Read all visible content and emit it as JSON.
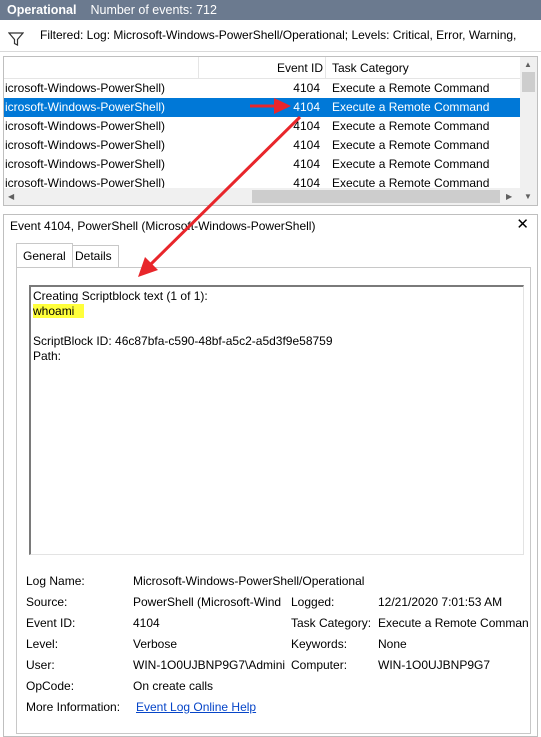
{
  "header": {
    "title": "Operational",
    "count_label": "Number of events: 712"
  },
  "filter": {
    "text": "Filtered: Log: Microsoft-Windows-PowerShell/Operational; Levels: Critical, Error, Warning,"
  },
  "columns": {
    "source": "",
    "event_id": "Event ID",
    "task_category": "Task Category"
  },
  "events": [
    {
      "source": "icrosoft-Windows-PowerShell)",
      "event_id": "4104",
      "task": "Execute a Remote Command",
      "selected": false
    },
    {
      "source": "icrosoft-Windows-PowerShell)",
      "event_id": "4104",
      "task": "Execute a Remote Command",
      "selected": true
    },
    {
      "source": "icrosoft-Windows-PowerShell)",
      "event_id": "4104",
      "task": "Execute a Remote Command",
      "selected": false
    },
    {
      "source": "icrosoft-Windows-PowerShell)",
      "event_id": "4104",
      "task": "Execute a Remote Command",
      "selected": false
    },
    {
      "source": "icrosoft-Windows-PowerShell)",
      "event_id": "4104",
      "task": "Execute a Remote Command",
      "selected": false
    },
    {
      "source": "icrosoft-Windows-PowerShell)",
      "event_id": "4104",
      "task": "Execute a Remote Command",
      "selected": false
    }
  ],
  "detail": {
    "title": "Event 4104, PowerShell (Microsoft-Windows-PowerShell)",
    "close_label": "✕",
    "tabs": {
      "general": "General",
      "details": "Details"
    },
    "message": {
      "line1": "Creating Scriptblock text (1 of 1):",
      "line2": "whoami",
      "line3": "ScriptBlock ID: 46c87bfa-c590-48bf-a5c2-a5d3f9e58759",
      "line4": "Path:"
    },
    "properties": {
      "log_name_label": "Log Name:",
      "log_name_value": "Microsoft-Windows-PowerShell/Operational",
      "source_label": "Source:",
      "source_value": "PowerShell (Microsoft-Wind",
      "logged_label": "Logged:",
      "logged_value": "12/21/2020 7:01:53 AM",
      "event_id_label": "Event ID:",
      "event_id_value": "4104",
      "task_category_label": "Task Category:",
      "task_category_value": "Execute a Remote Comman",
      "level_label": "Level:",
      "level_value": "Verbose",
      "keywords_label": "Keywords:",
      "keywords_value": "None",
      "user_label": "User:",
      "user_value": "WIN-1O0UJBNP9G7\\Admini",
      "computer_label": "Computer:",
      "computer_value": "WIN-1O0UJBNP9G7",
      "opcode_label": "OpCode:",
      "opcode_value": "On create calls",
      "more_info_label": "More Information:",
      "more_info_link": "Event Log Online Help"
    }
  },
  "colors": {
    "header_bg": "#6b7a8f",
    "selection": "#0078d7",
    "highlight": "#ffff3b",
    "annotation_arrow": "#e8262b",
    "link": "#0645c8"
  }
}
